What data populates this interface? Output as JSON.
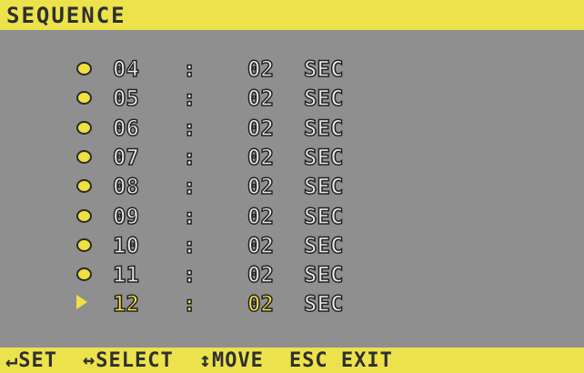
{
  "title": "SEQUENCE",
  "rows": [
    {
      "camera": "04",
      "sep": ":",
      "dwell": "02",
      "unit": "SEC",
      "selected": false
    },
    {
      "camera": "05",
      "sep": ":",
      "dwell": "02",
      "unit": "SEC",
      "selected": false
    },
    {
      "camera": "06",
      "sep": ":",
      "dwell": "02",
      "unit": "SEC",
      "selected": false
    },
    {
      "camera": "07",
      "sep": ":",
      "dwell": "02",
      "unit": "SEC",
      "selected": false
    },
    {
      "camera": "08",
      "sep": ":",
      "dwell": "02",
      "unit": "SEC",
      "selected": false
    },
    {
      "camera": "09",
      "sep": ":",
      "dwell": "02",
      "unit": "SEC",
      "selected": false
    },
    {
      "camera": "10",
      "sep": ":",
      "dwell": "02",
      "unit": "SEC",
      "selected": false
    },
    {
      "camera": "11",
      "sep": ":",
      "dwell": "02",
      "unit": "SEC",
      "selected": false
    },
    {
      "camera": "12",
      "sep": ":",
      "dwell": "02",
      "unit": "SEC",
      "selected": true
    }
  ],
  "footer": {
    "set": "↵SET",
    "select": "↔SELECT",
    "move": "↕MOVE",
    "esc": "ESC EXIT"
  },
  "colors": {
    "background": "#8f8f8f",
    "bar": "#ece24c",
    "highlight": "#f4e44a"
  }
}
